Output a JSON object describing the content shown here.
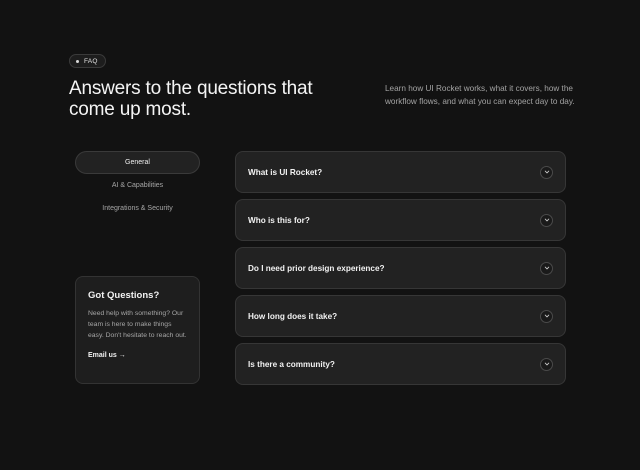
{
  "badge": {
    "label": "FAQ"
  },
  "headline": "Answers to the questions that come up most.",
  "subcopy": "Learn how UI Rocket works, what it covers, how the workflow flows, and what you can expect day to day.",
  "tabs": [
    {
      "label": "General",
      "active": true
    },
    {
      "label": "AI & Capabilities",
      "active": false
    },
    {
      "label": "Integrations & Security",
      "active": false
    }
  ],
  "contact_card": {
    "title": "Got Questions?",
    "text": "Need help with something? Our team is here to make things easy. Don't hesitate to reach out.",
    "link_label": "Email us →"
  },
  "faq": [
    {
      "question": "What is UI Rocket?"
    },
    {
      "question": "Who is this for?"
    },
    {
      "question": "Do I need prior design experience?"
    },
    {
      "question": "How long does it take?"
    },
    {
      "question": "Is there a community?"
    }
  ],
  "icons": {
    "expand": "chevron-down-icon",
    "badge_bullet": "dot-icon"
  },
  "colors": {
    "background": "#121212",
    "surface": "#222222",
    "border": "#363636",
    "muted_text": "#a3a3a3"
  }
}
